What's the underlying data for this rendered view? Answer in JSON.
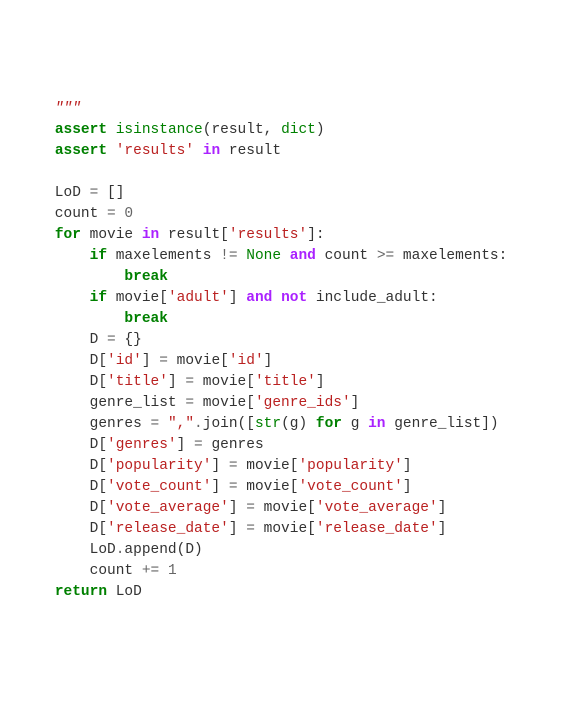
{
  "code": {
    "lines": [
      [
        {
          "cls": "nm",
          "t": "    "
        },
        {
          "cls": "strf",
          "t": "\"\"\""
        }
      ],
      [
        {
          "cls": "nm",
          "t": "    "
        },
        {
          "cls": "kw",
          "t": "assert"
        },
        {
          "cls": "nm",
          "t": " "
        },
        {
          "cls": "bi",
          "t": "isinstance"
        },
        {
          "cls": "nm",
          "t": "(result, "
        },
        {
          "cls": "bi",
          "t": "dict"
        },
        {
          "cls": "nm",
          "t": ")"
        }
      ],
      [
        {
          "cls": "nm",
          "t": "    "
        },
        {
          "cls": "kw",
          "t": "assert"
        },
        {
          "cls": "nm",
          "t": " "
        },
        {
          "cls": "str",
          "t": "'results'"
        },
        {
          "cls": "nm",
          "t": " "
        },
        {
          "cls": "ow",
          "t": "in"
        },
        {
          "cls": "nm",
          "t": " result"
        }
      ],
      [
        {
          "cls": "nm",
          "t": ""
        }
      ],
      [
        {
          "cls": "nm",
          "t": "    LoD "
        },
        {
          "cls": "op",
          "t": "="
        },
        {
          "cls": "nm",
          "t": " []"
        }
      ],
      [
        {
          "cls": "nm",
          "t": "    count "
        },
        {
          "cls": "op",
          "t": "="
        },
        {
          "cls": "nm",
          "t": " "
        },
        {
          "cls": "num",
          "t": "0"
        }
      ],
      [
        {
          "cls": "nm",
          "t": "    "
        },
        {
          "cls": "kw",
          "t": "for"
        },
        {
          "cls": "nm",
          "t": " movie "
        },
        {
          "cls": "ow",
          "t": "in"
        },
        {
          "cls": "nm",
          "t": " result["
        },
        {
          "cls": "str",
          "t": "'results'"
        },
        {
          "cls": "nm",
          "t": "]:"
        }
      ],
      [
        {
          "cls": "nm",
          "t": "        "
        },
        {
          "cls": "kw",
          "t": "if"
        },
        {
          "cls": "nm",
          "t": " maxelements "
        },
        {
          "cls": "op",
          "t": "!="
        },
        {
          "cls": "nm",
          "t": " "
        },
        {
          "cls": "nb",
          "t": "None"
        },
        {
          "cls": "nm",
          "t": " "
        },
        {
          "cls": "ow",
          "t": "and"
        },
        {
          "cls": "nm",
          "t": " count "
        },
        {
          "cls": "op",
          "t": ">="
        },
        {
          "cls": "nm",
          "t": " maxelements:"
        }
      ],
      [
        {
          "cls": "nm",
          "t": "            "
        },
        {
          "cls": "kw",
          "t": "break"
        }
      ],
      [
        {
          "cls": "nm",
          "t": "        "
        },
        {
          "cls": "kw",
          "t": "if"
        },
        {
          "cls": "nm",
          "t": " movie["
        },
        {
          "cls": "str",
          "t": "'adult'"
        },
        {
          "cls": "nm",
          "t": "] "
        },
        {
          "cls": "ow",
          "t": "and"
        },
        {
          "cls": "nm",
          "t": " "
        },
        {
          "cls": "ow",
          "t": "not"
        },
        {
          "cls": "nm",
          "t": " include_adult:"
        }
      ],
      [
        {
          "cls": "nm",
          "t": "            "
        },
        {
          "cls": "kw",
          "t": "break"
        }
      ],
      [
        {
          "cls": "nm",
          "t": "        D "
        },
        {
          "cls": "op",
          "t": "="
        },
        {
          "cls": "nm",
          "t": " {}"
        }
      ],
      [
        {
          "cls": "nm",
          "t": "        D["
        },
        {
          "cls": "str",
          "t": "'id'"
        },
        {
          "cls": "nm",
          "t": "] "
        },
        {
          "cls": "op",
          "t": "="
        },
        {
          "cls": "nm",
          "t": " movie["
        },
        {
          "cls": "str",
          "t": "'id'"
        },
        {
          "cls": "nm",
          "t": "]"
        }
      ],
      [
        {
          "cls": "nm",
          "t": "        D["
        },
        {
          "cls": "str",
          "t": "'title'"
        },
        {
          "cls": "nm",
          "t": "] "
        },
        {
          "cls": "op",
          "t": "="
        },
        {
          "cls": "nm",
          "t": " movie["
        },
        {
          "cls": "str",
          "t": "'title'"
        },
        {
          "cls": "nm",
          "t": "]"
        }
      ],
      [
        {
          "cls": "nm",
          "t": "        genre_list "
        },
        {
          "cls": "op",
          "t": "="
        },
        {
          "cls": "nm",
          "t": " movie["
        },
        {
          "cls": "str",
          "t": "'genre_ids'"
        },
        {
          "cls": "nm",
          "t": "]"
        }
      ],
      [
        {
          "cls": "nm",
          "t": "        genres "
        },
        {
          "cls": "op",
          "t": "="
        },
        {
          "cls": "nm",
          "t": " "
        },
        {
          "cls": "str",
          "t": "\",\""
        },
        {
          "cls": "op",
          "t": "."
        },
        {
          "cls": "nm",
          "t": "join(["
        },
        {
          "cls": "bi",
          "t": "str"
        },
        {
          "cls": "nm",
          "t": "(g) "
        },
        {
          "cls": "kw",
          "t": "for"
        },
        {
          "cls": "nm",
          "t": " g "
        },
        {
          "cls": "ow",
          "t": "in"
        },
        {
          "cls": "nm",
          "t": " genre_list])"
        }
      ],
      [
        {
          "cls": "nm",
          "t": "        D["
        },
        {
          "cls": "str",
          "t": "'genres'"
        },
        {
          "cls": "nm",
          "t": "] "
        },
        {
          "cls": "op",
          "t": "="
        },
        {
          "cls": "nm",
          "t": " genres"
        }
      ],
      [
        {
          "cls": "nm",
          "t": "        D["
        },
        {
          "cls": "str",
          "t": "'popularity'"
        },
        {
          "cls": "nm",
          "t": "] "
        },
        {
          "cls": "op",
          "t": "="
        },
        {
          "cls": "nm",
          "t": " movie["
        },
        {
          "cls": "str",
          "t": "'popularity'"
        },
        {
          "cls": "nm",
          "t": "]"
        }
      ],
      [
        {
          "cls": "nm",
          "t": "        D["
        },
        {
          "cls": "str",
          "t": "'vote_count'"
        },
        {
          "cls": "nm",
          "t": "] "
        },
        {
          "cls": "op",
          "t": "="
        },
        {
          "cls": "nm",
          "t": " movie["
        },
        {
          "cls": "str",
          "t": "'vote_count'"
        },
        {
          "cls": "nm",
          "t": "]"
        }
      ],
      [
        {
          "cls": "nm",
          "t": "        D["
        },
        {
          "cls": "str",
          "t": "'vote_average'"
        },
        {
          "cls": "nm",
          "t": "] "
        },
        {
          "cls": "op",
          "t": "="
        },
        {
          "cls": "nm",
          "t": " movie["
        },
        {
          "cls": "str",
          "t": "'vote_average'"
        },
        {
          "cls": "nm",
          "t": "]"
        }
      ],
      [
        {
          "cls": "nm",
          "t": "        D["
        },
        {
          "cls": "str",
          "t": "'release_date'"
        },
        {
          "cls": "nm",
          "t": "] "
        },
        {
          "cls": "op",
          "t": "="
        },
        {
          "cls": "nm",
          "t": " movie["
        },
        {
          "cls": "str",
          "t": "'release_date'"
        },
        {
          "cls": "nm",
          "t": "]"
        }
      ],
      [
        {
          "cls": "nm",
          "t": "        LoD"
        },
        {
          "cls": "op",
          "t": "."
        },
        {
          "cls": "nm",
          "t": "append(D)"
        }
      ],
      [
        {
          "cls": "nm",
          "t": "        count "
        },
        {
          "cls": "op",
          "t": "+="
        },
        {
          "cls": "nm",
          "t": " "
        },
        {
          "cls": "num",
          "t": "1"
        }
      ],
      [
        {
          "cls": "nm",
          "t": "    "
        },
        {
          "cls": "kw",
          "t": "return"
        },
        {
          "cls": "nm",
          "t": " LoD"
        }
      ]
    ]
  }
}
